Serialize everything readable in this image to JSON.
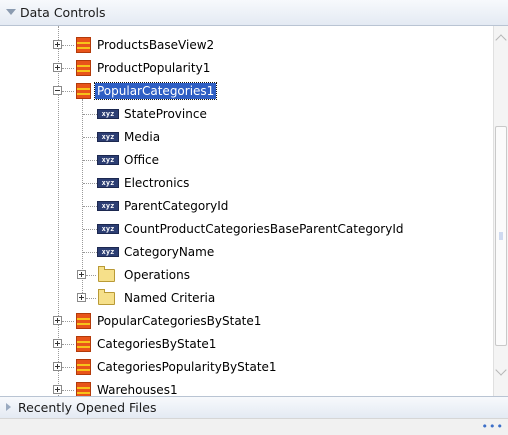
{
  "panel": {
    "title": "Data Controls"
  },
  "tree": {
    "items": [
      {
        "label": "ProductsBaseView2",
        "icon": "view-object-icon",
        "state": "collapsed"
      },
      {
        "label": "ProductPopularity1",
        "icon": "view-object-icon",
        "state": "collapsed"
      },
      {
        "label": "PopularCategories1",
        "icon": "view-object-icon",
        "state": "expanded",
        "selected": true
      },
      {
        "label": "StateProvince",
        "icon": "attribute-icon"
      },
      {
        "label": "Media",
        "icon": "attribute-icon"
      },
      {
        "label": "Office",
        "icon": "attribute-icon"
      },
      {
        "label": "Electronics",
        "icon": "attribute-icon"
      },
      {
        "label": "ParentCategoryId",
        "icon": "attribute-icon"
      },
      {
        "label": "CountProductCategoriesBaseParentCategoryId",
        "icon": "attribute-icon"
      },
      {
        "label": "CategoryName",
        "icon": "attribute-icon"
      },
      {
        "label": "Operations",
        "icon": "folder-icon",
        "state": "collapsed"
      },
      {
        "label": "Named Criteria",
        "icon": "folder-icon",
        "state": "collapsed"
      },
      {
        "label": "PopularCategoriesByState1",
        "icon": "view-object-icon",
        "state": "collapsed"
      },
      {
        "label": "CategoriesByState1",
        "icon": "view-object-icon",
        "state": "collapsed"
      },
      {
        "label": "CategoriesPopularityByState1",
        "icon": "view-object-icon",
        "state": "collapsed"
      },
      {
        "label": "Warehouses1",
        "icon": "view-object-icon",
        "state": "collapsed"
      }
    ],
    "attr_icon_text": "xyz"
  },
  "footer": {
    "title": "Recently Opened Files"
  },
  "status": {
    "dots": "•••"
  }
}
